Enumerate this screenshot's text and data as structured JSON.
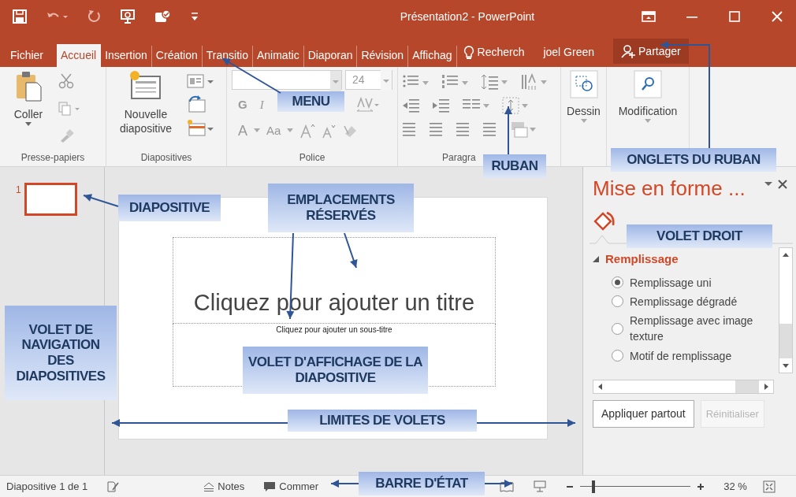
{
  "title_bar": {
    "title": "Présentation2 - PowerPoint"
  },
  "tabs": [
    {
      "label": "Fichier",
      "selected": false
    },
    {
      "label": "Accueil",
      "selected": true
    },
    {
      "label": "Insertion",
      "selected": false
    },
    {
      "label": "Création",
      "selected": false
    },
    {
      "label": "Transitio",
      "selected": false
    },
    {
      "label": "Animatic",
      "selected": false
    },
    {
      "label": "Diaporan",
      "selected": false
    },
    {
      "label": "Révision",
      "selected": false
    },
    {
      "label": "Affichag",
      "selected": false
    }
  ],
  "search": {
    "label": "Recherch"
  },
  "user": "joel Green",
  "share_button": "Partager",
  "ribbon": {
    "clipboard": {
      "paste": "Coller",
      "group": "Presse-papiers"
    },
    "slides": {
      "new_slide": "Nouvelle diapositive",
      "group": "Diapositives"
    },
    "font": {
      "size": "24",
      "format_buttons": [
        "G",
        "I"
      ],
      "case_buttons": [
        "A",
        "Aa"
      ],
      "group": "Police"
    },
    "paragraph": {
      "group": "Paragra"
    },
    "drawing": {
      "label": "Dessin"
    },
    "editing": {
      "label": "Modification"
    }
  },
  "slide_pane": {
    "slides": [
      {
        "number": "1",
        "selected": true
      }
    ]
  },
  "slide": {
    "title_placeholder": "Cliquez pour ajouter un titre",
    "subtitle_placeholder": "Cliquez pour ajouter un sous-titre"
  },
  "format_pane": {
    "title": "Mise en forme ...",
    "section": {
      "label": "Remplissage",
      "expanded": true
    },
    "options": [
      {
        "label": "Remplissage uni",
        "selected": true
      },
      {
        "label": "Remplissage dégradé",
        "selected": false
      },
      {
        "label": "Remplissage avec image texture",
        "selected": false
      },
      {
        "label": "Motif de remplissage",
        "selected": false
      }
    ],
    "buttons": [
      {
        "label": "Appliquer partout",
        "disabled": false
      },
      {
        "label": "Réinitialiser",
        "disabled": true
      }
    ]
  },
  "status_bar": {
    "slide_info": "Diapositive 1 de 1",
    "notes": "Notes",
    "comments": "Commer",
    "zoom": {
      "level": 0.12,
      "reading": "32 %"
    }
  },
  "annotations": [
    "MENU",
    "RUBAN",
    "ONGLETS DU RUBAN",
    "DIAPOSITIVE",
    "EMPLACEMENTS RÉSERVÉS",
    "VOLET DROIT",
    "VOLET DE NAVIGATION DES DIAPOSITIVES",
    "VOLET D'AFFICHAGE DE LA DIAPOSITIVE",
    "LIMITES DE VOLETS",
    "BARRE D'ÉTAT"
  ]
}
